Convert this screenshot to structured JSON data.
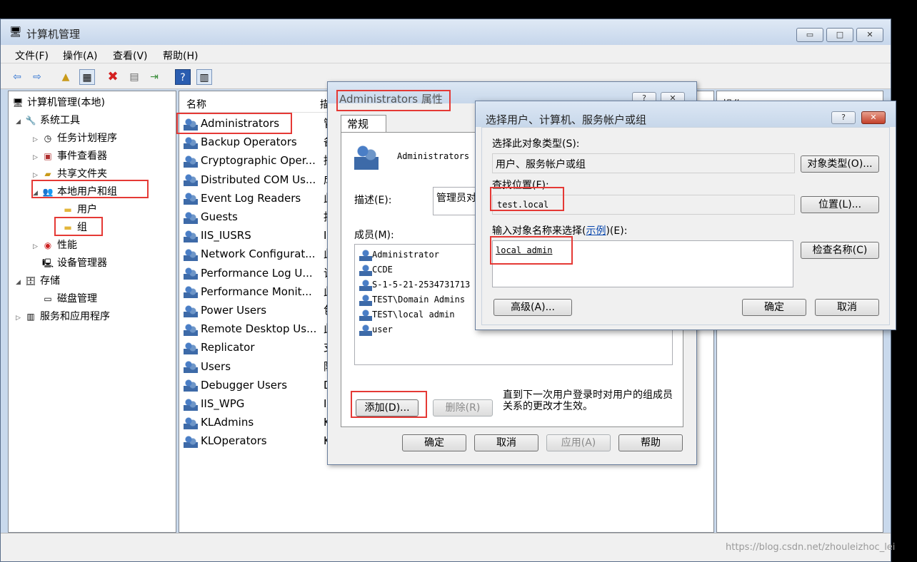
{
  "window": {
    "title": "计算机管理",
    "min": "▭",
    "max": "□",
    "close": "✕"
  },
  "menu": [
    "文件(F)",
    "操作(A)",
    "查看(V)",
    "帮助(H)"
  ],
  "tree": {
    "root": "计算机管理(本地)",
    "system_tools": "系统工具",
    "task_scheduler": "任务计划程序",
    "event_viewer": "事件查看器",
    "shared_folders": "共享文件夹",
    "local_users_groups": "本地用户和组",
    "users": "用户",
    "groups": "组",
    "performance": "性能",
    "device_manager": "设备管理器",
    "storage": "存储",
    "disk_management": "磁盘管理",
    "services_apps": "服务和应用程序"
  },
  "list": {
    "col_name": "名称",
    "col_desc": "描",
    "rows": [
      {
        "name": "Administrators",
        "desc": "管"
      },
      {
        "name": "Backup Operators",
        "desc": "备"
      },
      {
        "name": "Cryptographic Oper...",
        "desc": "授"
      },
      {
        "name": "Distributed COM Us...",
        "desc": "成"
      },
      {
        "name": "Event Log Readers",
        "desc": "此"
      },
      {
        "name": "Guests",
        "desc": "按"
      },
      {
        "name": "IIS_IUSRS",
        "desc": "In"
      },
      {
        "name": "Network Configurat...",
        "desc": "此"
      },
      {
        "name": "Performance Log U...",
        "desc": "该"
      },
      {
        "name": "Performance Monit...",
        "desc": "此"
      },
      {
        "name": "Power Users",
        "desc": "包"
      },
      {
        "name": "Remote Desktop Us...",
        "desc": "此"
      },
      {
        "name": "Replicator",
        "desc": "支"
      },
      {
        "name": "Users",
        "desc": "防"
      },
      {
        "name": "Debugger Users",
        "desc": "D"
      },
      {
        "name": "IIS_WPG",
        "desc": "II"
      },
      {
        "name": "KLAdmins",
        "desc": "K"
      },
      {
        "name": "KLOperators",
        "desc": "K"
      }
    ]
  },
  "actions": {
    "header": "操作"
  },
  "props": {
    "title": "Administrators 属性",
    "help": "?",
    "close": "✕",
    "tab": "常规",
    "group_name": "Administrators",
    "desc_label": "描述(E):",
    "desc_value": "管理员对",
    "members_label": "成员(M):",
    "members": [
      "Administrator",
      "CCDE",
      "S-1-5-21-2534731713",
      "TEST\\Domain Admins",
      "TEST\\local admin",
      "user"
    ],
    "add": "添加(D)...",
    "remove": "删除(R)",
    "note": "直到下一次用户登录时对用户的组成员关系的更改才生效。",
    "ok": "确定",
    "cancel": "取消",
    "apply": "应用(A)",
    "helpbtn": "帮助"
  },
  "select": {
    "title": "选择用户、计算机、服务帐户或组",
    "help": "?",
    "close": "✕",
    "type_label": "选择此对象类型(S):",
    "type_value": "用户、服务帐户或组",
    "type_btn": "对象类型(O)...",
    "loc_label": "查找位置(F):",
    "loc_value": "test.local",
    "loc_btn": "位置(L)...",
    "name_label_pre": "输入对象名称来选择(",
    "name_label_link": "示例",
    "name_label_post": ")(E):",
    "name_value": "local admin",
    "check_btn": "检查名称(C)",
    "advanced_btn": "高级(A)...",
    "ok": "确定",
    "cancel": "取消"
  },
  "watermark": "https://blog.csdn.net/zhouleizhoc_lei"
}
